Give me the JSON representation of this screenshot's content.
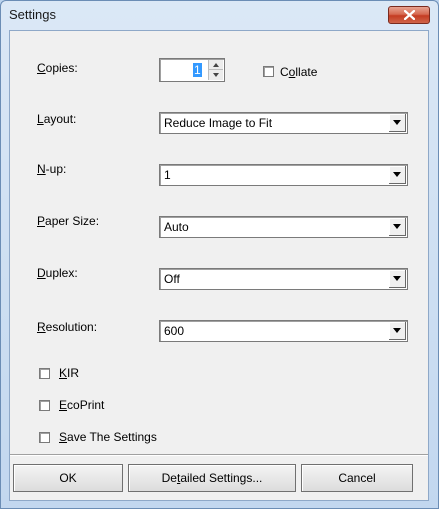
{
  "window": {
    "title": "Settings",
    "close_icon": "close-icon"
  },
  "fields": {
    "copies": {
      "label_pre": "",
      "label_u": "C",
      "label_post": "opies:",
      "value": "1"
    },
    "collate": {
      "label_pre": "C",
      "label_u": "o",
      "label_post": "llate",
      "checked": false
    },
    "layout": {
      "label_pre": "",
      "label_u": "L",
      "label_post": "ayout:",
      "value": "Reduce Image to Fit"
    },
    "nup": {
      "label_pre": "",
      "label_u": "N",
      "label_post": "-up:",
      "value": "1"
    },
    "paper_size": {
      "label_pre": "",
      "label_u": "P",
      "label_post": "aper Size:",
      "value": "Auto"
    },
    "duplex": {
      "label_pre": "",
      "label_u": "D",
      "label_post": "uplex:",
      "value": "Off"
    },
    "resolution": {
      "label_pre": "",
      "label_u": "R",
      "label_post": "esolution:",
      "value": "600"
    }
  },
  "checkboxes": {
    "kir": {
      "label_pre": "",
      "label_u": "K",
      "label_post": "IR",
      "checked": false
    },
    "ecoprint": {
      "label_pre": "",
      "label_u": "E",
      "label_post": "coPrint",
      "checked": false
    },
    "save": {
      "label_pre": "",
      "label_u": "S",
      "label_post": "ave The Settings",
      "checked": false
    }
  },
  "buttons": {
    "ok": "OK",
    "detailed_pre": "De",
    "detailed_u": "t",
    "detailed_post": "ailed Settings...",
    "cancel": "Cancel"
  }
}
